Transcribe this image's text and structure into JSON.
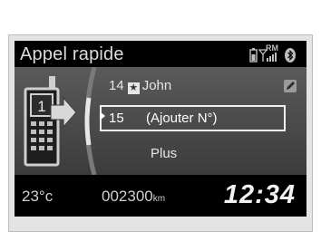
{
  "title": "Appel rapide",
  "status": {
    "roaming_label": "RM",
    "icons": [
      "phone-battery-icon",
      "signal-icon",
      "bluetooth-icon"
    ]
  },
  "menu": {
    "items": [
      {
        "number": "14",
        "name": "John",
        "badge_icon": "star-icon",
        "selected": false
      },
      {
        "number": "15",
        "name": "(Ajouter N°)",
        "selected": true
      },
      {
        "name": "Plus",
        "selected": false
      }
    ],
    "side_icon": "edit-phonebook-icon"
  },
  "footer": {
    "temperature": "23°c",
    "odometer": "002300",
    "odometer_unit": "km",
    "clock": "12:34"
  },
  "colors": {
    "screen": "#000000",
    "panel": "#4a4a4a",
    "text": "#e6e6e6",
    "highlight_border": "#f0f0f0"
  }
}
